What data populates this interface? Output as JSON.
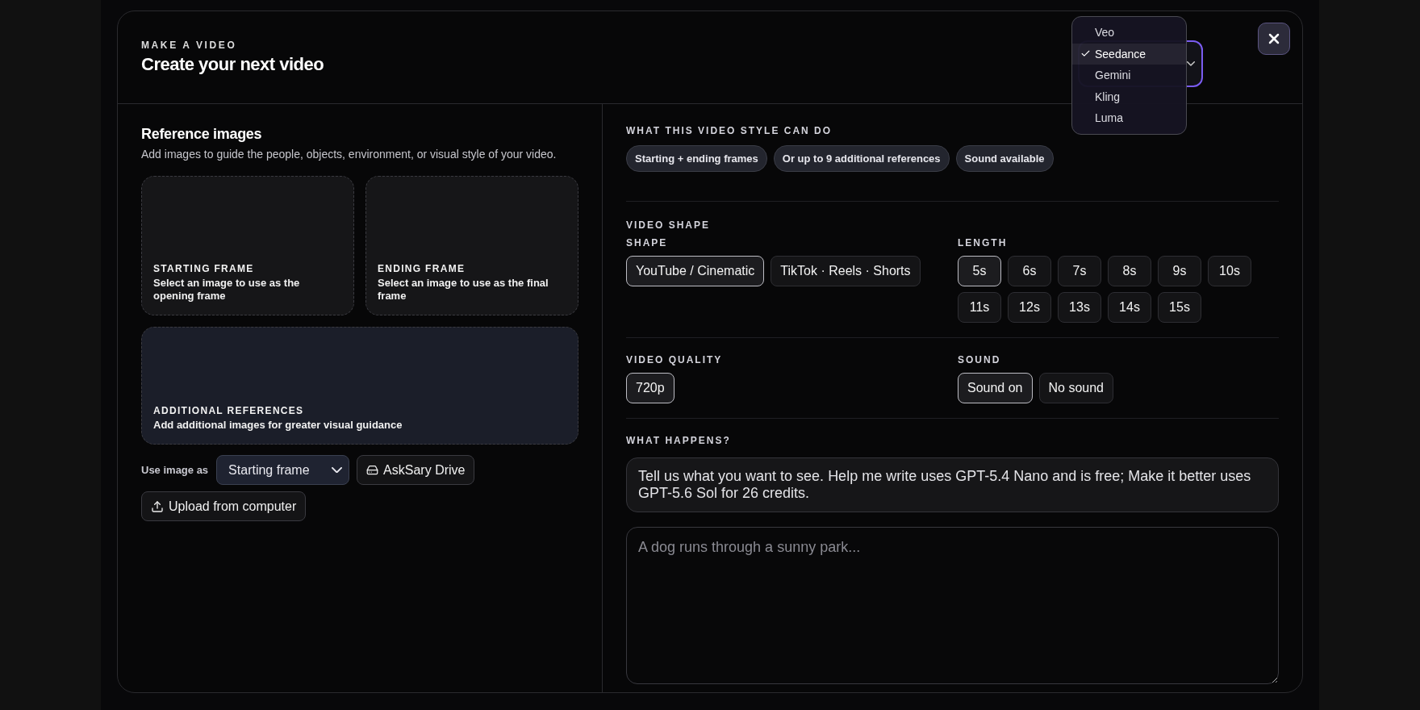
{
  "header": {
    "eyebrow": "MAKE A VIDEO",
    "title": "Create your next video"
  },
  "model_menu": {
    "items": [
      {
        "label": "Veo",
        "selected": false
      },
      {
        "label": "Seedance",
        "selected": true
      },
      {
        "label": "Gemini",
        "selected": false
      },
      {
        "label": "Kling",
        "selected": false
      },
      {
        "label": "Luma",
        "selected": false
      }
    ]
  },
  "reference": {
    "title": "Reference images",
    "subtitle": "Add images to guide the people, objects, environment, or visual style of your video.",
    "cards": [
      {
        "kind": "frame",
        "title": "STARTING FRAME",
        "description": "Select an image to use as the opening frame"
      },
      {
        "kind": "frame",
        "title": "ENDING FRAME",
        "description": "Select an image to use as the final frame"
      },
      {
        "kind": "wide",
        "title": "ADDITIONAL REFERENCES",
        "description": "Add additional images for greater visual guidance"
      }
    ],
    "use_image_label": "Use image as",
    "use_image_value": "Starting frame",
    "drive_button": "AskSary Drive",
    "upload_button": "Upload from computer"
  },
  "capabilities": {
    "label": "WHAT THIS VIDEO STYLE CAN DO",
    "chips": [
      "Starting + ending frames",
      "Or up to 9 additional references",
      "Sound available"
    ]
  },
  "video_shape": {
    "label": "VIDEO SHAPE",
    "shape": {
      "label": "SHAPE",
      "options": [
        {
          "label": "YouTube / Cinematic",
          "selected": true
        },
        {
          "label": "TikTok · Reels · Shorts",
          "selected": false
        }
      ]
    },
    "length": {
      "label": "LENGTH",
      "options": [
        {
          "label": "5s",
          "selected": true
        },
        {
          "label": "6s",
          "selected": false
        },
        {
          "label": "7s",
          "selected": false
        },
        {
          "label": "8s",
          "selected": false
        },
        {
          "label": "9s",
          "selected": false
        },
        {
          "label": "10s",
          "selected": false
        },
        {
          "label": "11s",
          "selected": false
        },
        {
          "label": "12s",
          "selected": false
        },
        {
          "label": "13s",
          "selected": false
        },
        {
          "label": "14s",
          "selected": false
        },
        {
          "label": "15s",
          "selected": false
        }
      ]
    }
  },
  "quality": {
    "label": "VIDEO QUALITY",
    "options": [
      {
        "label": "720p",
        "selected": true
      }
    ]
  },
  "sound": {
    "label": "SOUND",
    "options": [
      {
        "label": "Sound on",
        "selected": true
      },
      {
        "label": "No sound",
        "selected": false
      }
    ]
  },
  "what_happens": {
    "label": "WHAT HAPPENS?",
    "info": "Tell us what you want to see. Help me write uses GPT-5.4 Nano and is free; Make it better uses GPT-5.6 Sol for 26 credits.",
    "placeholder": "A dog runs through a sunny park..."
  }
}
